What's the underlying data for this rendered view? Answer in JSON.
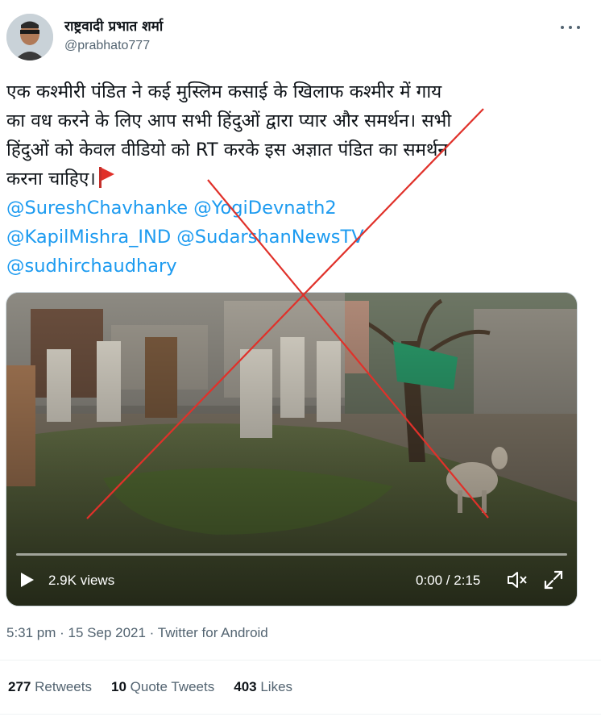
{
  "author": {
    "display_name": "राष्ट्रवादी प्रभात शर्मा",
    "handle": "@prabhato777"
  },
  "tweet": {
    "lines": [
      "एक कश्मीरी पंडित ने कई मुस्लिम कसाई के खिलाफ कश्मीर में गाय",
      "का वध करने के लिए आप सभी हिंदुओं द्वारा प्यार और समर्थन। सभी",
      "हिंदुओं को केवल वीडियो को  RT   करके इस अज्ञात पंडित का समर्थन",
      "करना चाहिए।"
    ],
    "mentions": [
      "@SureshChavhanke @YogiDevnath2",
      "@KapilMishra_IND @SudarshanNewsTV",
      "@sudhirchaudhary"
    ]
  },
  "video": {
    "views": "2.9K views",
    "time": "0:00 / 2:15",
    "progress": 0
  },
  "meta": {
    "timestamp": "5:31 pm · 15 Sep 2021 · Twitter for Android"
  },
  "stats": {
    "retweets_count": "277",
    "retweets_label": "Retweets",
    "quotes_count": "10",
    "quotes_label": "Quote Tweets",
    "likes_count": "403",
    "likes_label": "Likes"
  },
  "colors": {
    "link": "#1d9bf0",
    "text": "#0f1419",
    "secondary": "#536471",
    "cross": "#e0312a"
  }
}
